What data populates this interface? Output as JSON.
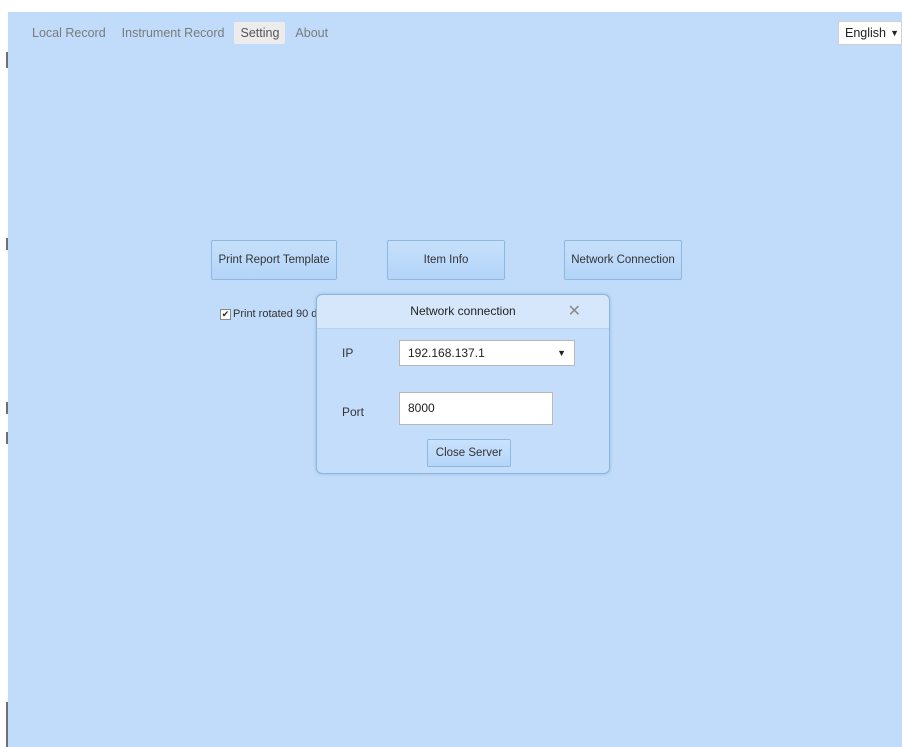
{
  "nav": {
    "tabs": [
      {
        "label": "Local Record"
      },
      {
        "label": "Instrument Record"
      },
      {
        "label": "Setting"
      },
      {
        "label": "About"
      }
    ],
    "active_tab": "Setting"
  },
  "language": {
    "selected": "English",
    "caret_icon": "caret-down-icon"
  },
  "settings": {
    "print_report_template": "Print Report Template",
    "item_info": "Item Info",
    "network_connection": "Network Connection",
    "print_rotated_label": "Print rotated 90 d",
    "print_rotated_checked": true
  },
  "dialog": {
    "title": "Network connection",
    "close_icon": "close-icon",
    "ip_label": "IP",
    "ip_value": "192.168.137.1",
    "port_label": "Port",
    "port_value": "8000",
    "close_server": "Close Server"
  },
  "colors": {
    "background": "#c0dcfa",
    "dialog_header": "#d6e7fc",
    "button": "#b3d4f8",
    "active_tab": "#ececec"
  }
}
